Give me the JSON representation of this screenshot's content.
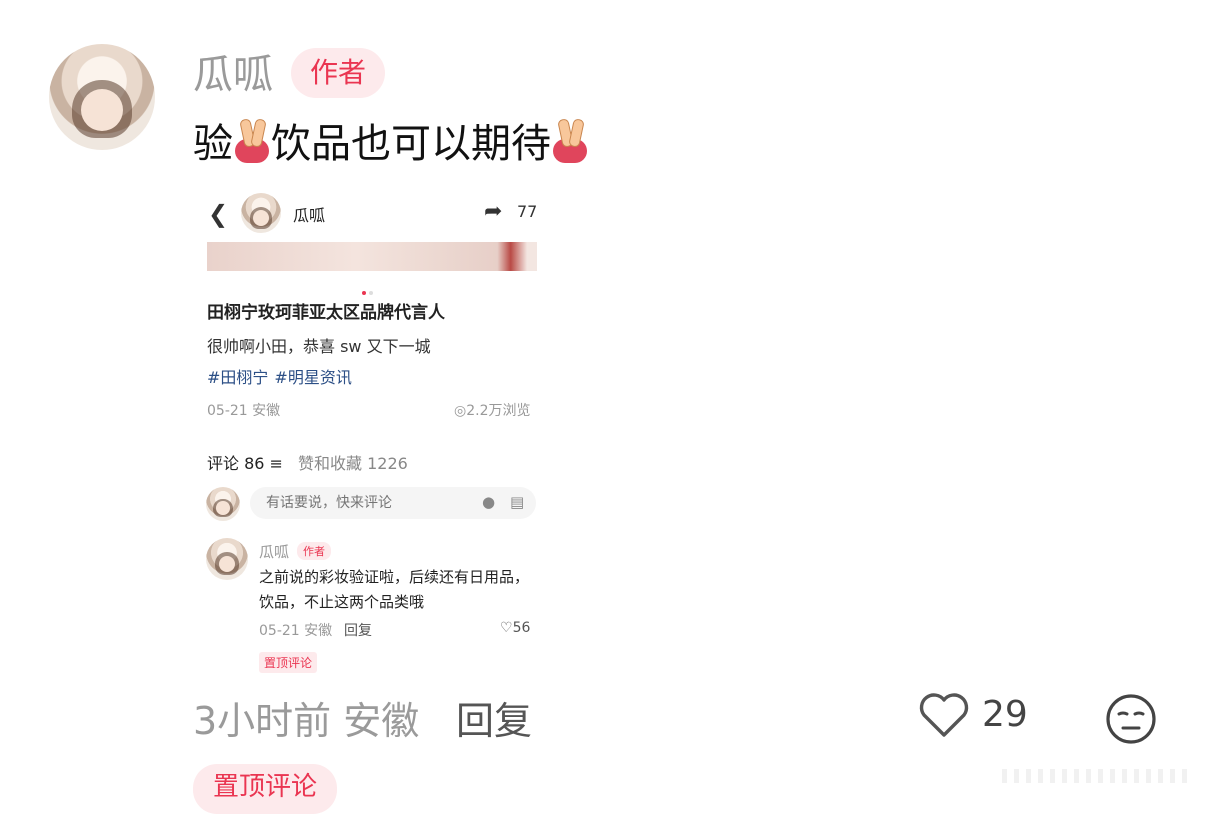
{
  "comment": {
    "username": "瓜呱",
    "author_badge": "作者",
    "text_part1": "验",
    "text_part2": "饮品也可以期待",
    "emoji_1": "victory-hand-emoji",
    "emoji_2": "victory-hand-emoji",
    "time_location": "3小时前 安徽",
    "reply_label": "回复",
    "like_count": "29",
    "pinned_label": "置顶评论"
  },
  "embedded_screenshot": {
    "header": {
      "author": "瓜呱",
      "share_count": "77"
    },
    "post": {
      "title": "田栩宁玫珂菲亚太区品牌代言人",
      "body": "很帅啊小田，恭喜 sw 又下一城",
      "tags": [
        "#田栩宁",
        "#明星资讯"
      ],
      "date_location": "05-21 安徽",
      "views": "2.2万浏览"
    },
    "stats": {
      "comments_label": "评论 86",
      "likes_favorites": "赞和收藏 1226"
    },
    "input_placeholder": "有话要说，快来评论",
    "pinned_comment": {
      "name": "瓜呱",
      "badge": "作者",
      "text": "之前说的彩妆验证啦，后续还有日用品，饮品，不止这两个品类哦",
      "time_location": "05-21 安徽",
      "reply_label": "回复",
      "likes": "56",
      "pinned_label": "置顶评论"
    }
  },
  "colors": {
    "accent": "#ea3551",
    "badge_bg": "#fdeaec",
    "tag_blue": "#2c4f86"
  }
}
